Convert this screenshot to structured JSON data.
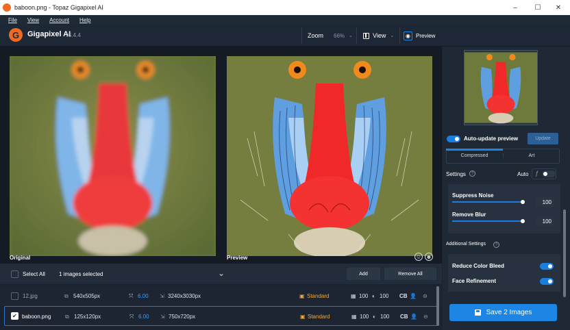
{
  "window": {
    "title": "baboon.png - Topaz Gigapixel AI",
    "min": "–",
    "max": "☐",
    "close": "✕"
  },
  "menu": {
    "file": "File",
    "view": "View",
    "account": "Account",
    "help": "Help"
  },
  "app": {
    "logo": "G",
    "name": "Gigapixel AI",
    "version": "v5.4.4"
  },
  "toolbar": {
    "zoom_label": "Zoom",
    "zoom_value": "66%",
    "view_label": "View",
    "preview_label": "Preview"
  },
  "viewer": {
    "original_label": "Original",
    "preview_label": "Preview"
  },
  "selection": {
    "select_all": "Select All",
    "count": "1 images selected",
    "add": "Add",
    "remove_all": "Remove All"
  },
  "files": [
    {
      "name": "12.jpg",
      "input": "540x505px",
      "scale": "6.00",
      "output": "3240x3030px",
      "model": "Standard",
      "quality": "100",
      "detail": "100",
      "cb": "CB",
      "checked": false
    },
    {
      "name": "baboon.png",
      "input": "125x120px",
      "scale": "6.00",
      "output": "750x720px",
      "model": "Standard",
      "quality": "100",
      "detail": "100",
      "cb": "CB",
      "checked": true
    }
  ],
  "panel": {
    "auto_update": "Auto-update preview",
    "update_button": "Update",
    "tab_compressed": "Compressed",
    "tab_art": "Art",
    "settings": "Settings",
    "auto": "Auto",
    "suppress_noise": "Suppress Noise",
    "suppress_noise_value": "100",
    "remove_blur": "Remove Blur",
    "remove_blur_value": "100",
    "additional_settings": "Additional Settings",
    "reduce_color_bleed": "Reduce Color Bleed",
    "face_refinement": "Face Refinement",
    "save_button": "Save 2 Images"
  },
  "colors": {
    "accent": "#1d86e4",
    "model": "#f0a93a",
    "scale": "#3aa0ff"
  }
}
